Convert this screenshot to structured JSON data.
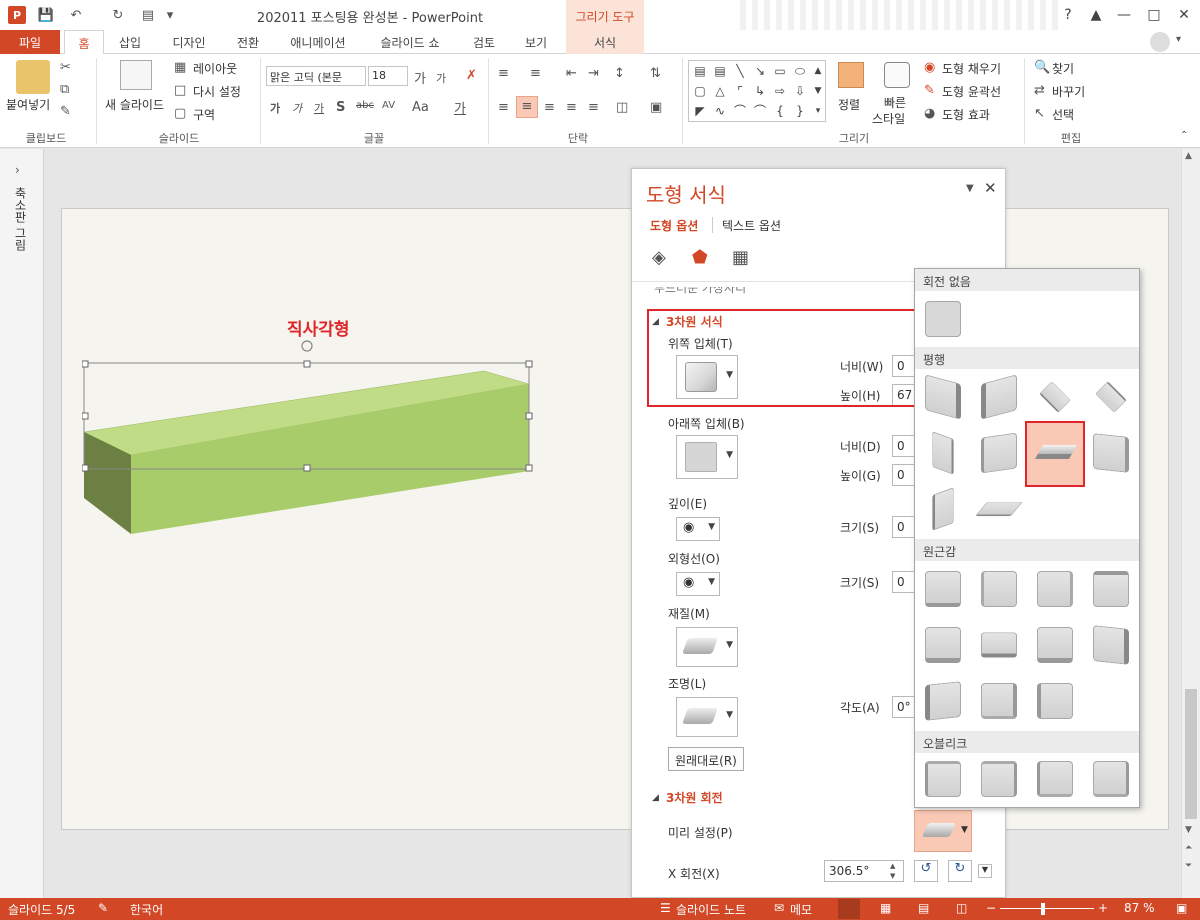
{
  "app": {
    "title": "202011 포스팅용 완성본 - PowerPoint",
    "context_tab_group": "그리기 도구",
    "help": "?"
  },
  "tabs": [
    {
      "label": "파일"
    },
    {
      "label": "홈"
    },
    {
      "label": "삽입"
    },
    {
      "label": "디자인"
    },
    {
      "label": "전환"
    },
    {
      "label": "애니메이션"
    },
    {
      "label": "슬라이드 쇼"
    },
    {
      "label": "검토"
    },
    {
      "label": "보기"
    },
    {
      "label": "서식"
    }
  ],
  "ribbon": {
    "clipboard": {
      "paste": "붙여넣기",
      "group": "클립보드"
    },
    "slides": {
      "new_slide": "새 슬라이드",
      "layout": "레이아웃",
      "reset": "다시 설정",
      "section": "구역",
      "group": "슬라이드"
    },
    "font": {
      "name": "맑은 고딕 (본문",
      "size": "18",
      "group": "글꼴"
    },
    "paragraph": {
      "group": "단락"
    },
    "drawing": {
      "arrange": "정렬",
      "quick_styles_1": "빠른",
      "quick_styles_2": "스타일",
      "fill": "도형 채우기",
      "outline": "도형 윤곽선",
      "effects": "도형 효과",
      "group": "그리기"
    },
    "editing": {
      "find": "찾기",
      "replace": "바꾸기",
      "select": "선택",
      "group": "편집"
    }
  },
  "left_pane": {
    "label": "축소판 그림"
  },
  "slide": {
    "shape_label": "직사각형"
  },
  "format_pane": {
    "title": "도형 서식",
    "tab_shape": "도형 옵션",
    "tab_text": "텍스트 옵션",
    "prev_section": "부드러운 가장자리",
    "sec_3d_format": "3차원 서식",
    "top_bevel": "위쪽 입체(T)",
    "width_w": "너비(W)",
    "width_w_val": "0",
    "height_h": "높이(H)",
    "height_h_val": "67",
    "bottom_bevel": "아래쪽 입체(B)",
    "width_d": "너비(D)",
    "width_d_val": "0",
    "height_g": "높이(G)",
    "height_g_val": "0",
    "depth": "깊이(E)",
    "size_s1": "크기(S)",
    "size_s1_val": "0",
    "contour": "외형선(O)",
    "size_s2": "크기(S)",
    "size_s2_val": "0",
    "material": "재질(M)",
    "lighting": "조명(L)",
    "angle": "각도(A)",
    "angle_val": "0°",
    "reset_btn": "원래대로(R)",
    "sec_3d_rotation": "3차원 회전",
    "presets": "미리 설정(P)",
    "x_rotation": "X 회전(X)",
    "x_rotation_val": "306.5°"
  },
  "gallery": {
    "no_rotation": "회전 없음",
    "parallel": "평행",
    "perspective": "원근감",
    "oblique": "오블리크"
  },
  "status": {
    "slide": "슬라이드 5/5",
    "language": "한국어",
    "notes": "슬라이드 노트",
    "comments": "메모",
    "zoom": "87 %"
  },
  "colors": {
    "accent": "#d24726",
    "shape_top": "#c0dc86",
    "shape_front": "#a9cc6a",
    "shape_side": "#6b8042",
    "highlight_box": "#e0262b"
  }
}
